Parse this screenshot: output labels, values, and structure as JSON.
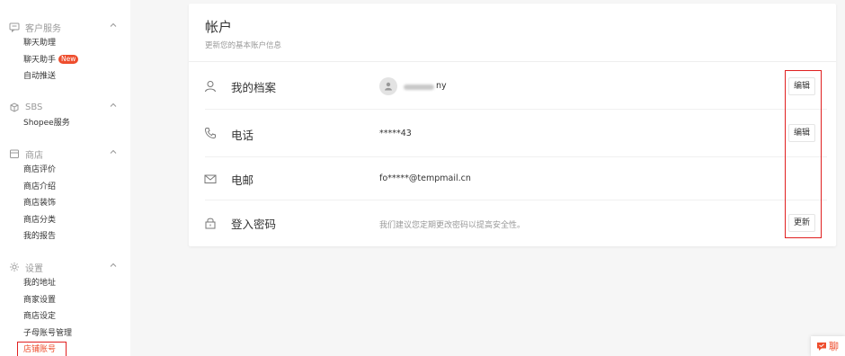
{
  "sidebar": {
    "sections": [
      {
        "title": "客户服务",
        "icon": "chat-icon",
        "items": [
          {
            "label": "聊天助理"
          },
          {
            "label": "聊天助手",
            "badge": "New"
          },
          {
            "label": "自动推送"
          }
        ]
      },
      {
        "title": "SBS",
        "icon": "box-icon",
        "items": [
          {
            "label": "Shopee服务"
          }
        ]
      },
      {
        "title": "商店",
        "icon": "store-icon",
        "items": [
          {
            "label": "商店评价"
          },
          {
            "label": "商店介绍"
          },
          {
            "label": "商店装饰"
          },
          {
            "label": "商店分类"
          },
          {
            "label": "我的报告"
          }
        ]
      },
      {
        "title": "设置",
        "icon": "gear-icon",
        "items": [
          {
            "label": "我的地址"
          },
          {
            "label": "商家设置"
          },
          {
            "label": "商店设定"
          },
          {
            "label": "子母账号管理"
          },
          {
            "label": "店铺账号",
            "active": true
          }
        ]
      }
    ]
  },
  "account": {
    "title": "帐户",
    "subtitle": "更新您的基本账户信息",
    "rows": [
      {
        "label": "我的档案",
        "icon": "person-icon",
        "value_suffix": "ny",
        "button": "编辑"
      },
      {
        "label": "电话",
        "icon": "phone-icon",
        "value": "*****43",
        "button": "编辑"
      },
      {
        "label": "电邮",
        "icon": "mail-icon",
        "value": "fo*****@tempmail.cn"
      },
      {
        "label": "登入密码",
        "icon": "lock-icon",
        "hint": "我们建议您定期更改密码以提高安全性。",
        "button": "更新"
      }
    ]
  },
  "chat_float": {
    "label": "聊",
    "icon": "chat-bubble-icon"
  },
  "colors": {
    "accent": "#ee4d2d",
    "annotation": "#e02020"
  }
}
